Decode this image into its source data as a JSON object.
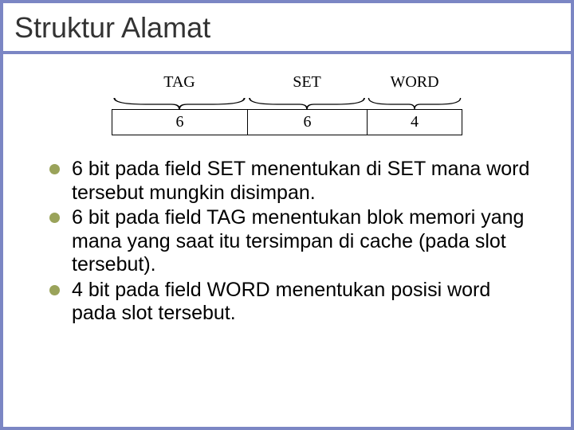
{
  "title": "Struktur Alamat",
  "diagram": {
    "fields": [
      {
        "label": "TAG",
        "bits": "6"
      },
      {
        "label": "SET",
        "bits": "6"
      },
      {
        "label": "WORD",
        "bits": "4"
      }
    ]
  },
  "bullets": [
    "6 bit pada field SET menentukan di SET mana word tersebut mungkin disimpan.",
    "6 bit pada field TAG menentukan blok memori yang mana yang saat itu tersimpan di cache (pada slot tersebut).",
    "4 bit pada field WORD menentukan posisi word pada slot tersebut."
  ]
}
